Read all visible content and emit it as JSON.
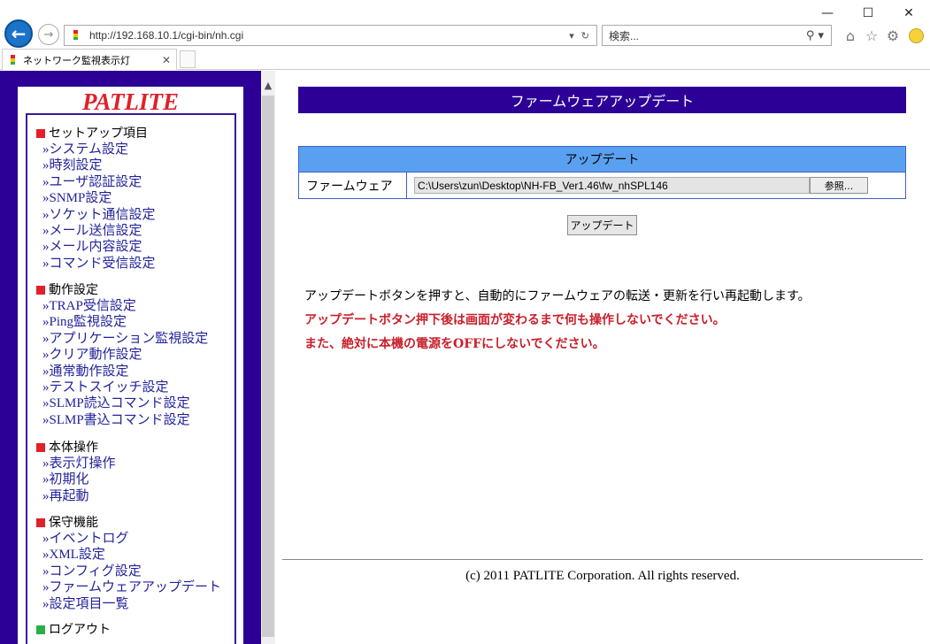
{
  "browser": {
    "url": "http://192.168.10.1/cgi-bin/nh.cgi",
    "search_placeholder": "検索...",
    "tab_title": "ネットワーク監視表示灯"
  },
  "nav": {
    "logo": "PATLITE",
    "sections": [
      {
        "heading": "セットアップ項目",
        "links": [
          "»システム設定",
          "»時刻設定",
          "»ユーザ認証設定",
          "»SNMP設定",
          "»ソケット通信設定",
          "»メール送信設定",
          "»メール内容設定",
          "»コマンド受信設定"
        ]
      },
      {
        "heading": "動作設定",
        "links": [
          "»TRAP受信設定",
          "»Ping監視設定",
          "»アプリケーション監視設定",
          "»クリア動作設定",
          "»通常動作設定",
          "»テストスイッチ設定",
          "»SLMP読込コマンド設定",
          "»SLMP書込コマンド設定"
        ]
      },
      {
        "heading": "本体操作",
        "links": [
          "»表示灯操作",
          "»初期化",
          "»再起動"
        ]
      },
      {
        "heading": "保守機能",
        "links": [
          "»イベントログ",
          "»XML設定",
          "»コンフィグ設定",
          "»ファームウェアアップデート",
          "»設定項目一覧"
        ]
      }
    ],
    "logout": "ログアウト"
  },
  "main": {
    "page_title": "ファームウェアアップデート",
    "table_header": "アップデート",
    "row_label": "ファームウェア",
    "file_value": "C:\\Users\\zun\\Desktop\\NH-FB_Ver1.46\\fw_nhSPL146",
    "browse_label": "参照...",
    "update_button": "アップデート",
    "message1": "アップデートボタンを押すと、自動的にファームウェアの転送・更新を行い再起動します。",
    "message2": "アップデートボタン押下後は画面が変わるまで何も操作しないでください。",
    "message3": "また、絶対に本機の電源をOFFにしないでください。",
    "copyright": "(c) 2011 PATLITE Corporation. All rights reserved."
  },
  "colors": {
    "nav_bg": "#2c0096",
    "logo": "#e0202a",
    "table_header_bg": "#5aa0f0",
    "warning_text": "#c8202a"
  }
}
